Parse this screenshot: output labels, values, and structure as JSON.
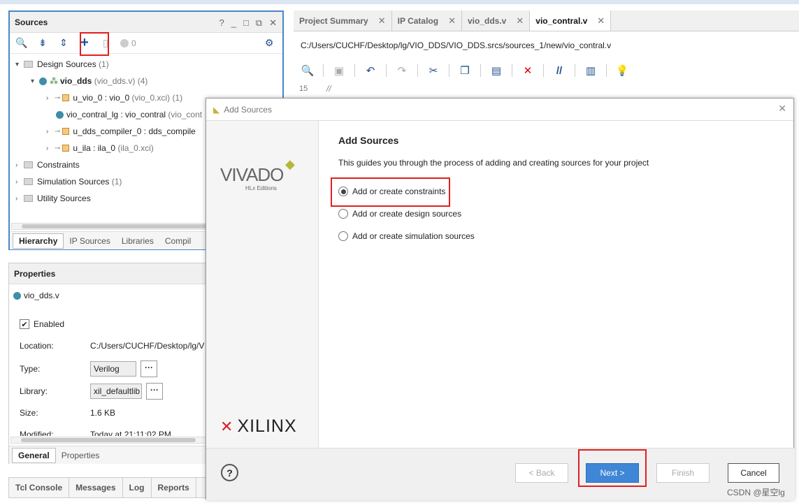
{
  "sources": {
    "title": "Sources",
    "toolbar_count": "0",
    "tree": [
      {
        "label": "Design Sources",
        "count": "(1)"
      },
      {
        "label": "vio_dds",
        "detail": "(vio_dds.v) (4)"
      },
      {
        "label": "u_vio_0 : vio_0",
        "detail": "(vio_0.xci) (1)"
      },
      {
        "label": "vio_contral_lg : vio_contral",
        "detail": "(vio_cont"
      },
      {
        "label": "u_dds_compiler_0 : dds_compile",
        "detail": ""
      },
      {
        "label": "u_ila : ila_0",
        "detail": "(ila_0.xci)"
      },
      {
        "label": "Constraints",
        "count": ""
      },
      {
        "label": "Simulation Sources",
        "count": "(1)"
      },
      {
        "label": "Utility Sources",
        "count": ""
      }
    ],
    "tabs": [
      "Hierarchy",
      "IP Sources",
      "Libraries",
      "Compil"
    ]
  },
  "properties": {
    "title": "Properties",
    "file": "vio_dds.v",
    "enabled": "Enabled",
    "location_label": "Location:",
    "location": "C:/Users/CUCHF/Desktop/lg/V",
    "type_label": "Type:",
    "type": "Verilog",
    "library_label": "Library:",
    "library": "xil_defaultlib",
    "size_label": "Size:",
    "size": "1.6 KB",
    "modified_label": "Modified:",
    "modified": "Today at 21:11:02 PM",
    "tabs": [
      "General",
      "Properties"
    ]
  },
  "bottom_tabs": [
    "Tcl Console",
    "Messages",
    "Log",
    "Reports"
  ],
  "editor": {
    "tabs": [
      "Project Summary",
      "IP Catalog",
      "vio_dds.v",
      "vio_contral.v"
    ],
    "path": "C:/Users/CUCHF/Desktop/lg/VIO_DDS/VIO_DDS.srcs/sources_1/new/vio_contral.v",
    "line": "15",
    "code": "//"
  },
  "dialog": {
    "title": "Add Sources",
    "heading": "Add Sources",
    "description": "This guides you through the process of adding and creating sources for your project",
    "options": [
      "Add or create constraints",
      "Add or create design sources",
      "Add or create simulation sources"
    ],
    "vivado": "VIVADO",
    "hlx": "HLx Editions",
    "xilinx": "XILINX",
    "help": "?",
    "back": "< Back",
    "next": "Next >",
    "finish": "Finish",
    "cancel": "Cancel"
  },
  "watermark": "CSDN @星空lg"
}
